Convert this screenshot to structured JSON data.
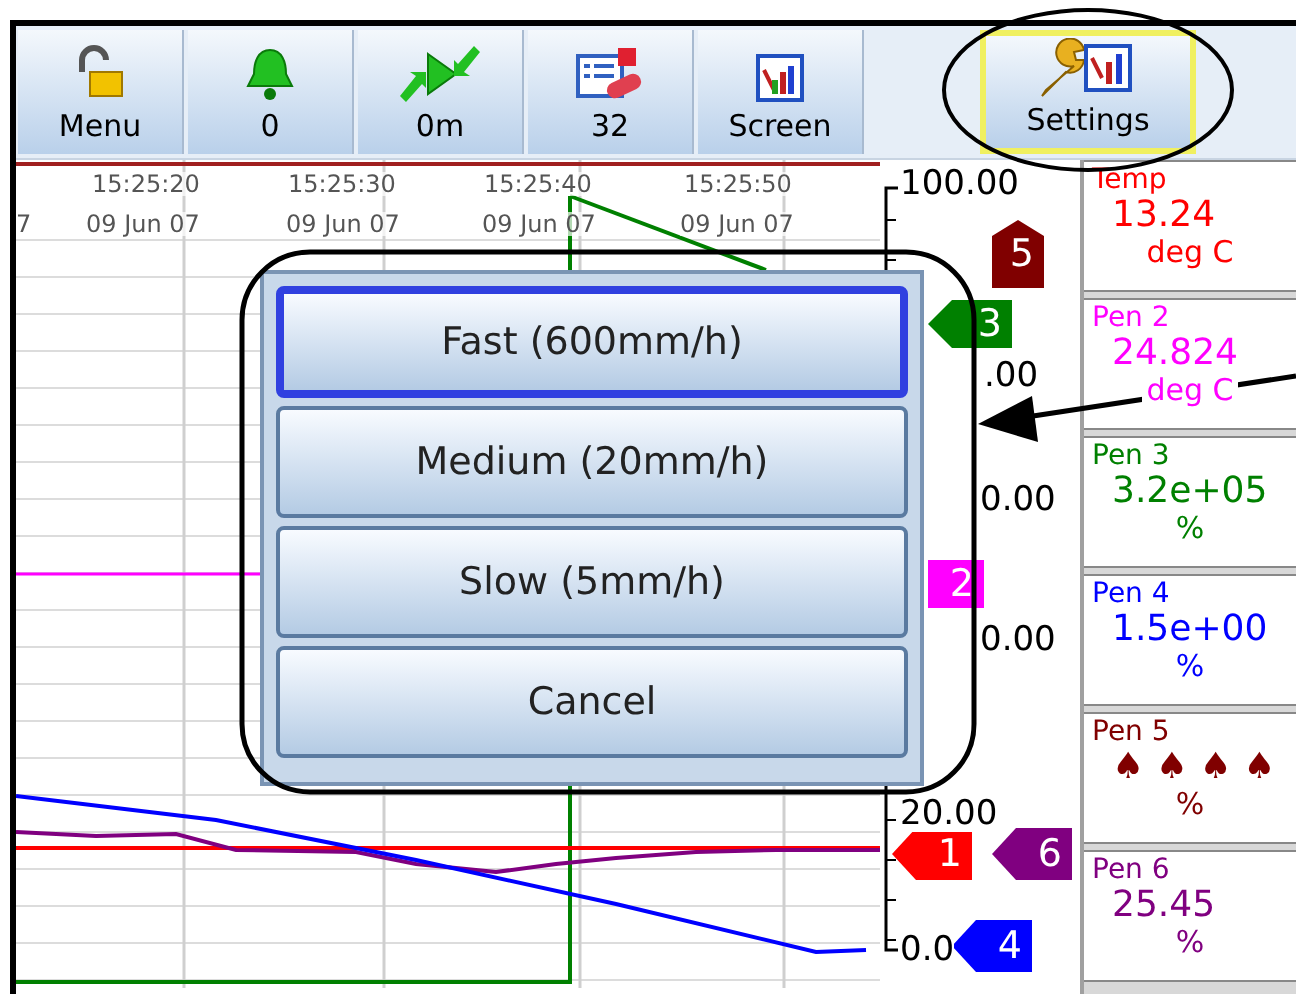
{
  "toolbar": {
    "buttons": [
      {
        "kind": "lock",
        "label": "Menu",
        "selected": false
      },
      {
        "kind": "bell",
        "label": "0",
        "selected": false
      },
      {
        "kind": "play",
        "label": "0m",
        "selected": false
      },
      {
        "kind": "list",
        "label": "32",
        "selected": false
      },
      {
        "kind": "screen",
        "label": "Screen",
        "selected": false
      },
      {
        "kind": "settings",
        "label": "Settings",
        "selected": true
      }
    ]
  },
  "chart": {
    "time_labels": [
      "15:25:20",
      "15:25:30",
      "15:25:40",
      "15:25:50"
    ],
    "date_labels": [
      "7",
      "09 Jun 07",
      "09 Jun 07",
      "09 Jun 07",
      "09 Jun 07"
    ],
    "scale_labels": [
      "100.00",
      ".00",
      "0.00",
      "0.00",
      "20.00",
      "0.0"
    ],
    "pen_tags": [
      {
        "label": "5",
        "color": "#800000",
        "kind": "up"
      },
      {
        "label": "3",
        "color": "#008000",
        "kind": "left"
      },
      {
        "label": "2",
        "color": "#ff00ff",
        "kind": "flat"
      },
      {
        "label": "1",
        "color": "#ff0000",
        "kind": "left"
      },
      {
        "label": "6",
        "color": "#800080",
        "kind": "left"
      },
      {
        "label": "4",
        "color": "#0000ff",
        "kind": "left"
      }
    ]
  },
  "dialog": {
    "options": [
      {
        "label": "Fast (600mm/h)",
        "selected": true
      },
      {
        "label": "Medium (20mm/h)",
        "selected": false
      },
      {
        "label": "Slow (5mm/h)",
        "selected": false
      },
      {
        "label": "Cancel",
        "selected": false
      }
    ]
  },
  "pens": [
    {
      "name": "Temp",
      "value": "13.24",
      "unit": "deg C",
      "color": "#ff0000"
    },
    {
      "name": "Pen 2",
      "value": "24.824",
      "unit": "deg C",
      "color": "#ff00ff"
    },
    {
      "name": "Pen 3",
      "value": "3.2e+05",
      "unit": "%",
      "color": "#008000"
    },
    {
      "name": "Pen 4",
      "value": "1.5e+00",
      "unit": "%",
      "color": "#0000ff"
    },
    {
      "name": "Pen 5",
      "value": "♠ ♠ ♠ ♠",
      "unit": "%",
      "color": "#800000"
    },
    {
      "name": "Pen 6",
      "value": "25.45",
      "unit": "%",
      "color": "#800080"
    }
  ]
}
